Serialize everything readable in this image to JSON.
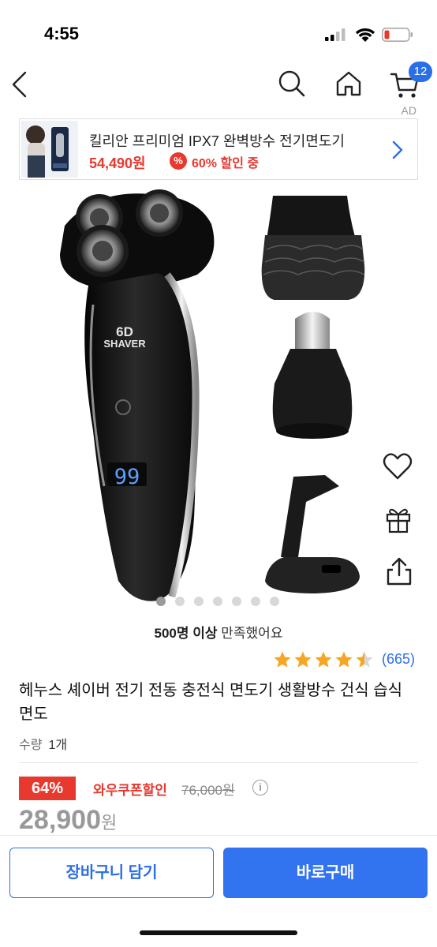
{
  "status_bar": {
    "time": "4:55",
    "icons": [
      "signal-icon",
      "wifi-icon",
      "battery-low-icon"
    ]
  },
  "nav": {
    "icons": [
      "back-icon",
      "search-icon",
      "home-icon",
      "cart-icon"
    ],
    "cart_count": "12",
    "ad_label": "AD"
  },
  "ad_banner": {
    "title": "킬리안 프리미엄 IPX7 완벽방수 전기면도기",
    "price": "54,490원",
    "discount_icon": "%",
    "discount": "60% 할인 중"
  },
  "gallery": {
    "brand_text": "SHAVER",
    "display_text": "99",
    "image_count": 7,
    "active_index": 0
  },
  "side_actions": [
    "heart-icon",
    "gift-icon",
    "share-icon"
  ],
  "satisfaction": {
    "bold": "500명 이상",
    "rest": " 만족했어요"
  },
  "rating": {
    "stars": 4.5,
    "count": "(665)"
  },
  "product": {
    "title": "헤누스 셰이버 전기 전동 충전식 면도기 생활방수 건식 습식 면도",
    "qty_label": "수량",
    "qty_value": "1개"
  },
  "pricing": {
    "discount_rate": "64%",
    "coupon_label": "와우쿠폰할인",
    "original_price": "76,000원",
    "final_price": "28,900",
    "currency": "원"
  },
  "actions": {
    "add_to_cart": "장바구니 담기",
    "buy_now": "바로구매"
  },
  "colors": {
    "accent_blue": "#3273f0",
    "discount_red": "#e8392f",
    "star_gold": "#f5a623"
  }
}
